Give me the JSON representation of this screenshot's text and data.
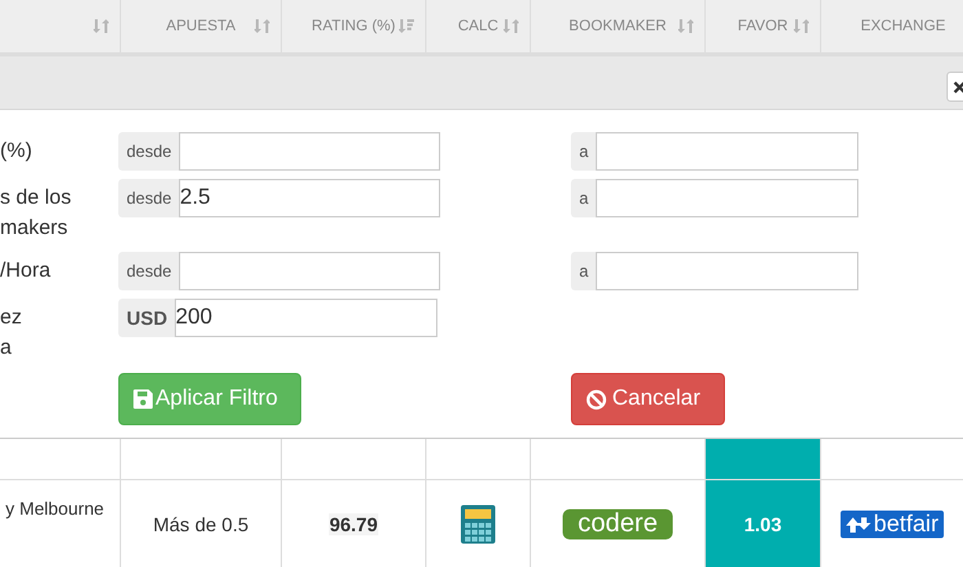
{
  "table": {
    "columns": [
      {
        "sorted": false
      },
      {
        "label": "APUESTA",
        "sorted": false
      },
      {
        "label": "RATING (%)",
        "sorted": true
      },
      {
        "label": "CALC",
        "sorted": false
      },
      {
        "label": "BOOKMAKER",
        "sorted": false
      },
      {
        "label": "FAVOR",
        "sorted": false
      },
      {
        "label": "EXCHANGE"
      }
    ],
    "rows": [
      {
        "covered": true
      },
      {
        "event": "y Melbourne",
        "bet": "Más de 0.5",
        "rating": "96.79",
        "bookmaker": "codere",
        "favor": "1.03",
        "exchange": "betfair"
      }
    ]
  },
  "filter_panel": {
    "fields": [
      {
        "kind": "range",
        "label_lines": [
          "(%)"
        ],
        "from_addon": "desde",
        "to_addon": "a"
      },
      {
        "kind": "range",
        "label_lines": [
          "s de los",
          "makers"
        ],
        "from_addon": "desde",
        "from_value": "2.5",
        "to_addon": "a"
      },
      {
        "kind": "range",
        "label_lines": [
          "/Hora"
        ],
        "from_addon": "desde",
        "to_addon": "a"
      },
      {
        "kind": "currency",
        "label_lines": [
          "ez",
          "a"
        ],
        "addon": "USD",
        "value": "200"
      }
    ],
    "buttons": [
      {
        "kind": "apply",
        "label": "Aplicar Filtro"
      },
      {
        "kind": "cancel",
        "label": "Cancelar"
      }
    ]
  }
}
